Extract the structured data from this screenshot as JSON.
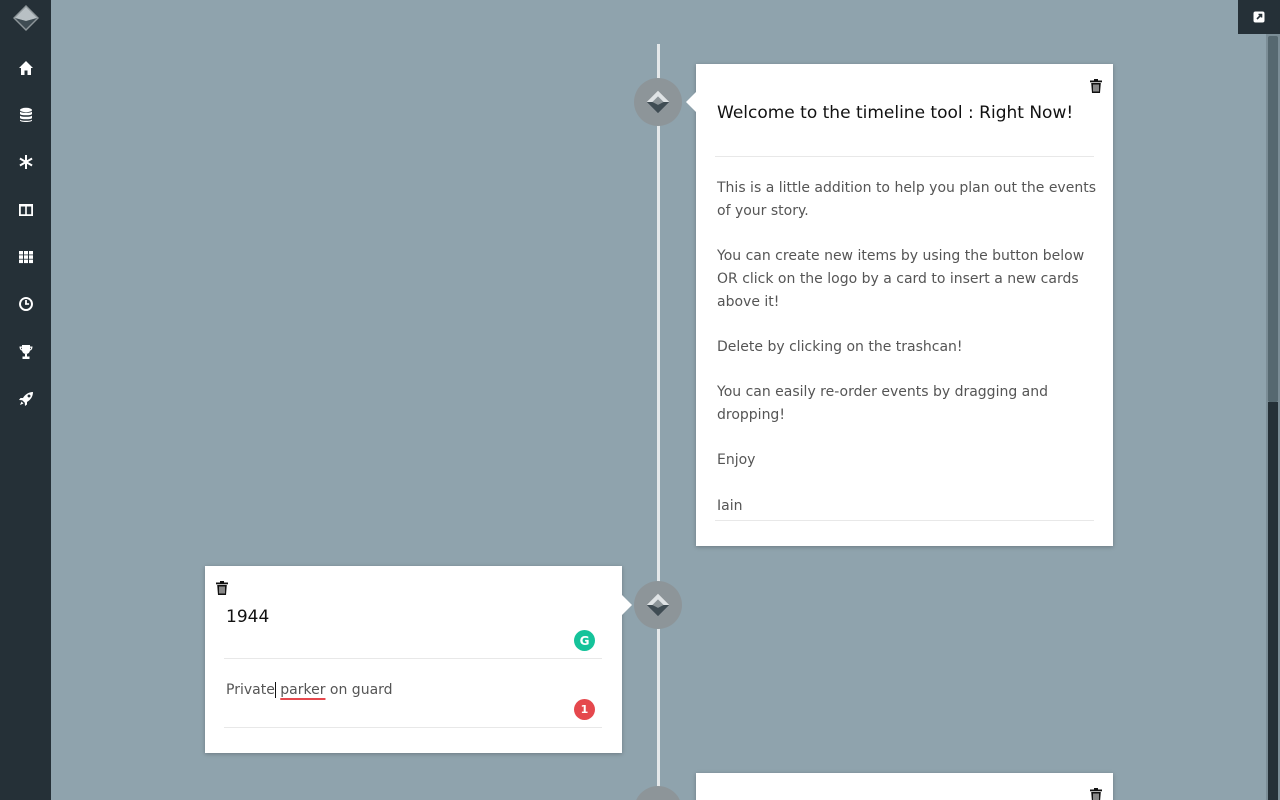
{
  "sidebar": {
    "items": [
      {
        "icon": "home-icon"
      },
      {
        "icon": "database-icon"
      },
      {
        "icon": "snowflake-icon"
      },
      {
        "icon": "columns-icon"
      },
      {
        "icon": "grid-icon"
      },
      {
        "icon": "clock-icon"
      },
      {
        "icon": "trophy-icon"
      },
      {
        "icon": "rocket-icon"
      }
    ]
  },
  "cards": [
    {
      "title": "Welcome to the timeline tool : Right Now!",
      "body": "This is a little addition to help you plan out the events of your story.\n\nYou can create new items by using the button below OR  click on the logo by a card to insert a new cards above it!\n\nDelete by clicking on the trashcan!\n\nYou can easily re-order events by dragging and dropping!\n\nEnjoy\n\nIain"
    },
    {
      "title": "1944",
      "body_before": "Private",
      "body_word": "parker",
      "body_after": " on guard",
      "badge_count": "1",
      "grammarly_label": "G"
    }
  ],
  "colors": {
    "background": "#8fa3ad",
    "sidebar": "#253037",
    "grammarly": "#15c39a",
    "error": "#e5484d"
  }
}
